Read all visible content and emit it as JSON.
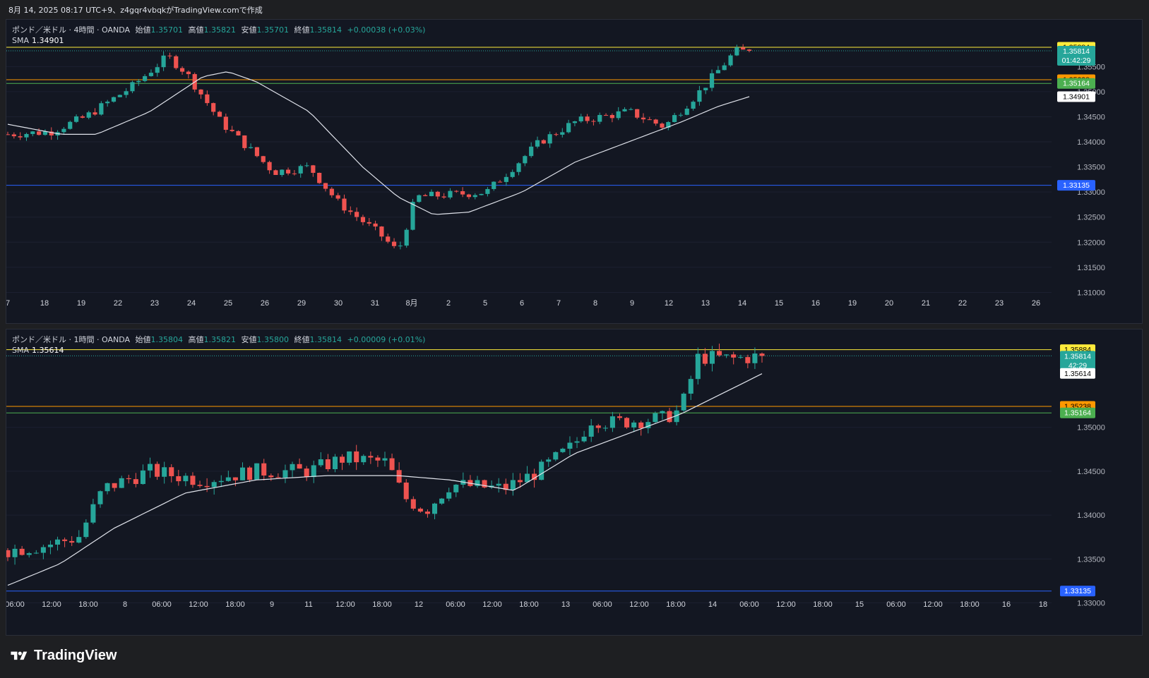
{
  "header": {
    "caption": "8月 14, 2025 08:17 UTC+9、z4gqr4vbqkがTradingView.comで作成"
  },
  "brand": {
    "name": "TradingView"
  },
  "colors": {
    "bg": "#131722",
    "up": "#26a69a",
    "down": "#ef5350",
    "sma": "#e0e3eb",
    "line_yellow": "#ffeb3b",
    "line_orange": "#ff9800",
    "line_green": "#4caf50",
    "line_blue": "#2962ff",
    "grid": "#1c2030"
  },
  "chart_data": [
    {
      "type": "candlestick",
      "pane": "top",
      "legend": {
        "symbol": "ポンド／米ドル · 4時間 · OANDA",
        "open_label": "始値",
        "open": "1.35701",
        "high_label": "高値",
        "high": "1.35821",
        "low_label": "安値",
        "low": "1.35701",
        "close_label": "終値",
        "close": "1.35814",
        "change": "+0.00038 (+0.03%)"
      },
      "sma_legend": {
        "label": "SMA",
        "value": "1.34901"
      },
      "ylim": [
        1.3095,
        1.3632
      ],
      "y_ticks": [
        "1.35500",
        "1.35000",
        "1.34500",
        "1.34000",
        "1.33500",
        "1.33000",
        "1.32500",
        "1.32000",
        "1.31500",
        "1.31000"
      ],
      "x_ticks": [
        "7",
        "18",
        "19",
        "22",
        "23",
        "24",
        "25",
        "26",
        "29",
        "30",
        "31",
        "8月",
        "2",
        "5",
        "6",
        "7",
        "8",
        "9",
        "12",
        "13",
        "14",
        "15",
        "16",
        "19",
        "20",
        "21",
        "22",
        "23",
        "26"
      ],
      "hlines": [
        {
          "price": "1.35884",
          "color": "#ffeb3b"
        },
        {
          "price": "1.35238",
          "color": "#ff9800"
        },
        {
          "price": "1.35164",
          "color": "#4caf50"
        },
        {
          "price": "1.33135",
          "color": "#2962ff"
        }
      ],
      "price_labels": [
        {
          "text": "1.35884",
          "bg": "#ffeb3b",
          "fg": "#000000"
        },
        {
          "text": "1.35814",
          "sub": "01:42:29",
          "bg": "#26a69a",
          "fg": "#ffffff"
        },
        {
          "text": "1.35238",
          "bg": "#ff9800",
          "fg": "#000000"
        },
        {
          "text": "1.35164",
          "bg": "#4caf50",
          "fg": "#ffffff"
        },
        {
          "text": "1.34901",
          "bg": "#ffffff",
          "fg": "#000000"
        },
        {
          "text": "1.33135",
          "bg": "#2962ff",
          "fg": "#ffffff"
        }
      ],
      "candle_count": 120,
      "close_path": [
        [
          0,
          1.3415
        ],
        [
          12,
          1.342
        ],
        [
          22,
          1.345
        ],
        [
          35,
          1.351
        ],
        [
          45,
          1.357
        ],
        [
          50,
          1.354
        ],
        [
          60,
          1.344
        ],
        [
          75,
          1.334
        ],
        [
          85,
          1.335
        ],
        [
          93,
          1.328
        ],
        [
          105,
          1.3215
        ],
        [
          110,
          1.318
        ],
        [
          115,
          1.329
        ],
        [
          135,
          1.33
        ],
        [
          150,
          1.34
        ],
        [
          160,
          1.344
        ],
        [
          175,
          1.346
        ],
        [
          185,
          1.343
        ],
        [
          195,
          1.35
        ],
        [
          200,
          1.354
        ],
        [
          205,
          1.358
        ],
        [
          209,
          1.3581
        ]
      ],
      "sma_path": [
        [
          0,
          1.3435
        ],
        [
          15,
          1.3415
        ],
        [
          25,
          1.3415
        ],
        [
          40,
          1.346
        ],
        [
          55,
          1.353
        ],
        [
          62,
          1.354
        ],
        [
          70,
          1.352
        ],
        [
          85,
          1.346
        ],
        [
          100,
          1.335
        ],
        [
          110,
          1.329
        ],
        [
          120,
          1.3255
        ],
        [
          130,
          1.326
        ],
        [
          145,
          1.33
        ],
        [
          160,
          1.336
        ],
        [
          175,
          1.34
        ],
        [
          190,
          1.344
        ],
        [
          200,
          1.347
        ],
        [
          209,
          1.349
        ]
      ]
    },
    {
      "type": "candlestick",
      "pane": "bottom",
      "legend": {
        "symbol": "ポンド／米ドル · 1時間 · OANDA",
        "open_label": "始値",
        "open": "1.35804",
        "high_label": "高値",
        "high": "1.35821",
        "low_label": "安値",
        "low": "1.35800",
        "close_label": "終値",
        "close": "1.35814",
        "change": "+0.00009 (+0.01%)"
      },
      "sma_legend": {
        "label": "SMA",
        "value": "1.35614"
      },
      "ylim": [
        1.3298,
        1.3605
      ],
      "y_ticks": [
        "1.35000",
        "1.34500",
        "1.34000",
        "1.33500",
        "1.33000"
      ],
      "x_ticks": [
        "06:00",
        "12:00",
        "18:00",
        "8",
        "06:00",
        "12:00",
        "18:00",
        "9",
        "11",
        "12:00",
        "18:00",
        "12",
        "06:00",
        "12:00",
        "18:00",
        "13",
        "06:00",
        "12:00",
        "18:00",
        "14",
        "06:00",
        "12:00",
        "18:00",
        "15",
        "06:00",
        "12:00",
        "18:00",
        "16",
        "18"
      ],
      "hlines": [
        {
          "price": "1.35884",
          "color": "#ffeb3b"
        },
        {
          "price": "1.35238",
          "color": "#ff9800"
        },
        {
          "price": "1.35164",
          "color": "#4caf50"
        },
        {
          "price": "1.33135",
          "color": "#2962ff"
        }
      ],
      "price_labels": [
        {
          "text": "1.35884",
          "bg": "#ffeb3b",
          "fg": "#000000"
        },
        {
          "text": "1.35814",
          "sub": "42:29",
          "bg": "#26a69a",
          "fg": "#ffffff"
        },
        {
          "text": "1.35614",
          "bg": "#ffffff",
          "fg": "#000000"
        },
        {
          "text": "1.35238",
          "bg": "#ff9800",
          "fg": "#000000"
        },
        {
          "text": "1.35164",
          "bg": "#4caf50",
          "fg": "#ffffff"
        },
        {
          "text": "1.33135",
          "bg": "#2962ff",
          "fg": "#ffffff"
        }
      ],
      "candle_count": 107,
      "close_path": [
        [
          0,
          1.336
        ],
        [
          10,
          1.3365
        ],
        [
          20,
          1.3375
        ],
        [
          27,
          1.343
        ],
        [
          40,
          1.345
        ],
        [
          55,
          1.344
        ],
        [
          70,
          1.345
        ],
        [
          85,
          1.345
        ],
        [
          95,
          1.3465
        ],
        [
          107,
          1.346
        ],
        [
          112,
          1.342
        ],
        [
          118,
          1.3405
        ],
        [
          125,
          1.3435
        ],
        [
          140,
          1.343
        ],
        [
          150,
          1.345
        ],
        [
          160,
          1.348
        ],
        [
          165,
          1.351
        ],
        [
          170,
          1.3505
        ],
        [
          185,
          1.351
        ],
        [
          190,
          1.352
        ],
        [
          195,
          1.358
        ],
        [
          205,
          1.3578
        ],
        [
          213,
          1.3581
        ]
      ],
      "sma_path": [
        [
          0,
          1.332
        ],
        [
          15,
          1.3345
        ],
        [
          30,
          1.3385
        ],
        [
          50,
          1.3425
        ],
        [
          70,
          1.344
        ],
        [
          90,
          1.3445
        ],
        [
          110,
          1.3445
        ],
        [
          125,
          1.344
        ],
        [
          143,
          1.3428
        ],
        [
          160,
          1.347
        ],
        [
          180,
          1.35
        ],
        [
          190,
          1.3515
        ],
        [
          200,
          1.3535
        ],
        [
          213,
          1.3561
        ]
      ]
    }
  ]
}
